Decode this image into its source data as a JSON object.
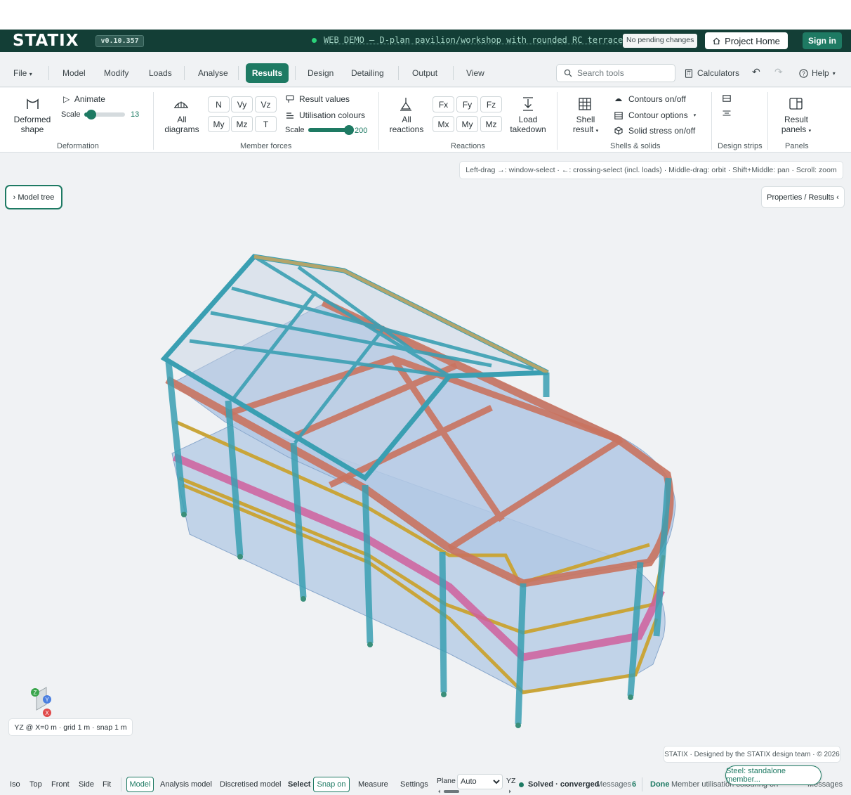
{
  "topbar": {
    "logo": "STATIX",
    "version": "v0.10.357",
    "project_title": "WEB DEMO — D-plan pavilion/workshop with rounded RC terraces",
    "pending": "No pending changes",
    "project_home": "Project Home",
    "sign_in": "Sign in"
  },
  "menu": {
    "file": "File",
    "model": "Model",
    "modify": "Modify",
    "loads": "Loads",
    "analyse": "Analyse",
    "results": "Results",
    "design": "Design",
    "detailing": "Detailing",
    "output": "Output",
    "view": "View",
    "search_placeholder": "Search tools",
    "calculators": "Calculators",
    "help": "Help"
  },
  "ribbon": {
    "deformation": {
      "label": "Deformation",
      "deformed_shape_1": "Deformed",
      "deformed_shape_2": "shape",
      "animate": "Animate",
      "scale_label": "Scale",
      "scale_value": "13",
      "scale_fraction": 0.18
    },
    "member_forces": {
      "label": "Member forces",
      "all_diagrams_1": "All",
      "all_diagrams_2": "diagrams",
      "buttons_row1": [
        "N",
        "Vy",
        "Vz"
      ],
      "buttons_row2": [
        "My",
        "Mz",
        "T"
      ],
      "result_values": "Result values",
      "utilisation_colours": "Utilisation colours",
      "scale_label": "Scale",
      "scale_value": "200",
      "scale_fraction": 1.0
    },
    "reactions": {
      "label": "Reactions",
      "all_reactions_1": "All",
      "all_reactions_2": "reactions",
      "buttons_row1": [
        "Fx",
        "Fy",
        "Fz"
      ],
      "buttons_row2": [
        "Mx",
        "My",
        "Mz"
      ],
      "load_takedown_1": "Load",
      "load_takedown_2": "takedown"
    },
    "shells": {
      "label": "Shells & solids",
      "shell_result_1": "Shell",
      "shell_result_2": "result",
      "contours_onoff": "Contours on/off",
      "contour_options": "Contour options",
      "solid_stress": "Solid stress on/off"
    },
    "design_strips": {
      "label": "Design strips"
    },
    "panels": {
      "label": "Panels",
      "result_panels_1": "Result",
      "result_panels_2": "panels"
    }
  },
  "viewport": {
    "hint": "Left-drag →: window-select · ←: crossing-select (incl. loads) · Middle-drag: orbit · Shift+Middle: pan · Scroll: zoom",
    "model_tree": "› Model tree",
    "properties_results": "Properties / Results ‹",
    "grid_info": "YZ @ X=0 m · grid 1 m · snap 1 m",
    "credit": "STATIX · Designed by the STATIX design team · © 2026",
    "axis_z": "Z",
    "axis_y": "Y",
    "axis_x": "X"
  },
  "bottombar": {
    "iso": "Iso",
    "top": "Top",
    "front": "Front",
    "side": "Side",
    "fit": "Fit",
    "model": "Model",
    "analysis_model": "Analysis model",
    "discretised_model": "Discretised model",
    "select": "Select",
    "snap_on": "Snap on",
    "measure": "Measure",
    "settings": "Settings",
    "plane_label": "Plane",
    "plane_value": "Auto",
    "plane_axis": "YZ",
    "solved": "Solved · converged",
    "messages_label": "Messages",
    "messages_count": "6",
    "done": "Done",
    "status_text": "Member utilisation colouring on",
    "messages_right": "Messages",
    "toast": "Steel: standalone member..."
  },
  "colors": {
    "brand_dark": "#133e36",
    "accent": "#1e7a63",
    "steel": "#3a9fb2",
    "concrete_beam": "#c9735f",
    "slab": "#b2c8e4",
    "yellow_beam": "#c9a53a",
    "pink_beam": "#cf5f9c"
  }
}
